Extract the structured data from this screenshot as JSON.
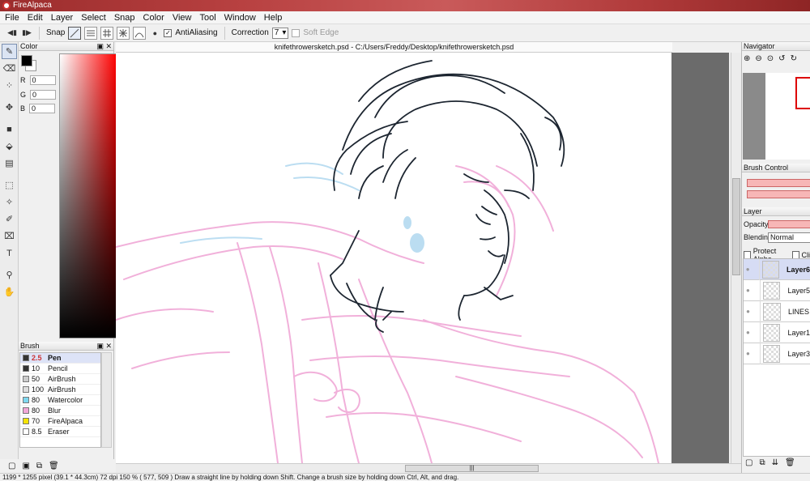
{
  "app": {
    "title": "FireAlpaca"
  },
  "menu": [
    "File",
    "Edit",
    "Layer",
    "Select",
    "Snap",
    "Color",
    "View",
    "Tool",
    "Window",
    "Help"
  ],
  "toolbar": {
    "snap_label": "Snap",
    "antialiasing_label": "AntiAliasing",
    "antialiasing_checked": true,
    "correction_label": "Correction",
    "correction_value": "7",
    "soft_edge_label": "Soft Edge",
    "soft_edge_checked": false
  },
  "color_panel": {
    "title": "Color",
    "r": "0",
    "g": "0",
    "b": "0",
    "r_label": "R",
    "g_label": "G",
    "b_label": "B",
    "foreground": "#000000",
    "background": "#ffffff"
  },
  "brush_panel": {
    "title": "Brush",
    "items": [
      {
        "size": "2.5",
        "name": "Pen",
        "color": "#333333",
        "active": true
      },
      {
        "size": "10",
        "name": "Pencil",
        "color": "#333333"
      },
      {
        "size": "50",
        "name": "AirBrush",
        "color": "#cccccc"
      },
      {
        "size": "100",
        "name": "AirBrush",
        "color": "#dddddd"
      },
      {
        "size": "80",
        "name": "Watercolor",
        "color": "#7fd8f0"
      },
      {
        "size": "80",
        "name": "Blur",
        "color": "#f2a6d8"
      },
      {
        "size": "70",
        "name": "FireAlpaca",
        "color": "#f5e400"
      },
      {
        "size": "8.5",
        "name": "Eraser",
        "color": "#ffffff"
      }
    ]
  },
  "document": {
    "tab_label": "knifethrowersketch.psd - C:/Users/Freddy/Desktop/knifethrowersketch.psd"
  },
  "navigator": {
    "title": "Navigator"
  },
  "brush_control": {
    "title": "Brush Control"
  },
  "layer_panel": {
    "title": "Layer",
    "opacity_label": "Opacity",
    "blending_label": "Blending",
    "blending_value": "Normal",
    "protect_alpha_label": "Protect Alpha",
    "clipping_label": "Cli",
    "layers": [
      {
        "name": "Layer6",
        "active": true
      },
      {
        "name": "Layer5"
      },
      {
        "name": "LINES"
      },
      {
        "name": "Layer1"
      },
      {
        "name": "Layer3"
      }
    ]
  },
  "status": {
    "text": "1199 * 1255 pixel  (39.1 * 44.3cm)  72 dpi  150 %  ( 577, 509 )  Draw a straight line by holding down Shift. Change a brush size by holding down Ctrl, Alt, and drag."
  },
  "icons": {
    "tools": [
      "pen-tool-icon",
      "eraser-icon",
      "dot-icon",
      "move-icon",
      "fill-rect-icon",
      "bucket-icon",
      "gradient-icon",
      "select-rect-icon",
      "magic-wand-icon",
      "select-pen-icon",
      "select-eraser-icon",
      "text-icon",
      "eyedropper-icon",
      "hand-icon"
    ]
  }
}
